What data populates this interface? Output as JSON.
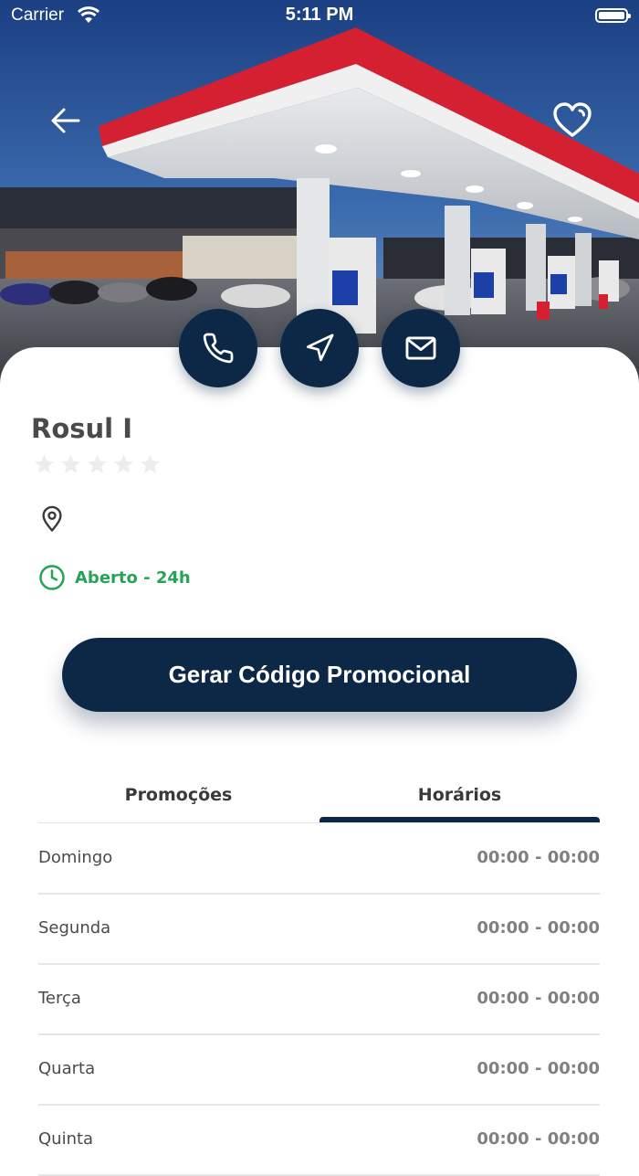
{
  "status_bar": {
    "carrier": "Carrier",
    "time": "5:11 PM"
  },
  "station": {
    "name": "Rosul I",
    "rating": 0,
    "rating_max": 5,
    "status": "Aberto - 24h"
  },
  "promo_button": {
    "label": "Gerar Código Promocional"
  },
  "tabs": [
    {
      "label": "Promoções",
      "active": false
    },
    {
      "label": "Horários",
      "active": true
    }
  ],
  "schedule": [
    {
      "day": "Domingo",
      "hours": "00:00 - 00:00"
    },
    {
      "day": "Segunda",
      "hours": "00:00 - 00:00"
    },
    {
      "day": "Terça",
      "hours": "00:00 - 00:00"
    },
    {
      "day": "Quarta",
      "hours": "00:00 - 00:00"
    },
    {
      "day": "Quinta",
      "hours": "00:00 - 00:00"
    }
  ],
  "icons": {
    "back": "arrow-left-icon",
    "favorite": "heart-icon",
    "phone": "phone-icon",
    "navigate": "navigation-arrow-icon",
    "email": "mail-icon",
    "location": "map-pin-icon",
    "clock": "clock-icon",
    "star": "star-icon"
  },
  "colors": {
    "primary": "#0d2847",
    "open_status": "#27a356",
    "accent_canopy": "#d42030",
    "star_empty": "#ededed",
    "muted_text": "#808080"
  }
}
